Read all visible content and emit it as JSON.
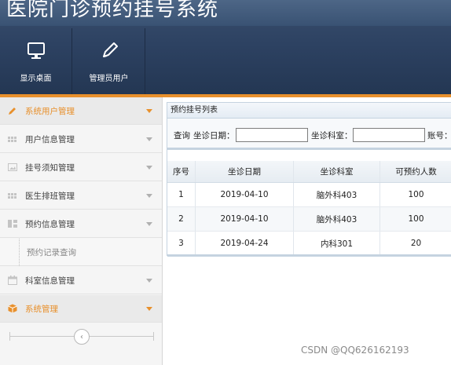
{
  "app": {
    "title": "医院门诊预约挂号系统"
  },
  "toolbar": {
    "items": [
      {
        "label": "显示桌面",
        "icon": "monitor-icon"
      },
      {
        "label": "管理员用户",
        "icon": "pencil-icon"
      }
    ]
  },
  "sidebar": {
    "items": [
      {
        "label": "系统用户管理",
        "icon": "pencil-icon",
        "state": "orange"
      },
      {
        "label": "用户信息管理",
        "icon": "grid-icon"
      },
      {
        "label": "挂号须知管理",
        "icon": "image-icon"
      },
      {
        "label": "医生排班管理",
        "icon": "grid-icon"
      },
      {
        "label": "预约信息管理",
        "icon": "columns-icon"
      },
      {
        "label": "预约记录查询",
        "sub": true
      },
      {
        "label": "科室信息管理",
        "icon": "calendar-icon"
      },
      {
        "label": "系统管理",
        "icon": "box-icon",
        "state": "orange-active"
      }
    ],
    "collapse_glyph": "‹"
  },
  "panel": {
    "title": "预约挂号列表",
    "search": {
      "query_label": "查询",
      "date_label": "坐诊日期：",
      "date_value": "",
      "dept_label": "坐诊科室：",
      "dept_value": "",
      "account_label": "账号："
    },
    "table": {
      "columns": [
        "序号",
        "坐诊日期",
        "坐诊科室",
        "可预约人数"
      ],
      "rows": [
        [
          "1",
          "2019-04-10",
          "脑外科403",
          "100"
        ],
        [
          "2",
          "2019-04-10",
          "脑外科403",
          "100"
        ],
        [
          "3",
          "2019-04-24",
          "内科301",
          "20"
        ]
      ]
    }
  },
  "watermark": "CSDN @QQ626162193",
  "colors": {
    "accent": "#e8902c",
    "header": "#2d4262",
    "panel_border": "#c5d3e0"
  }
}
